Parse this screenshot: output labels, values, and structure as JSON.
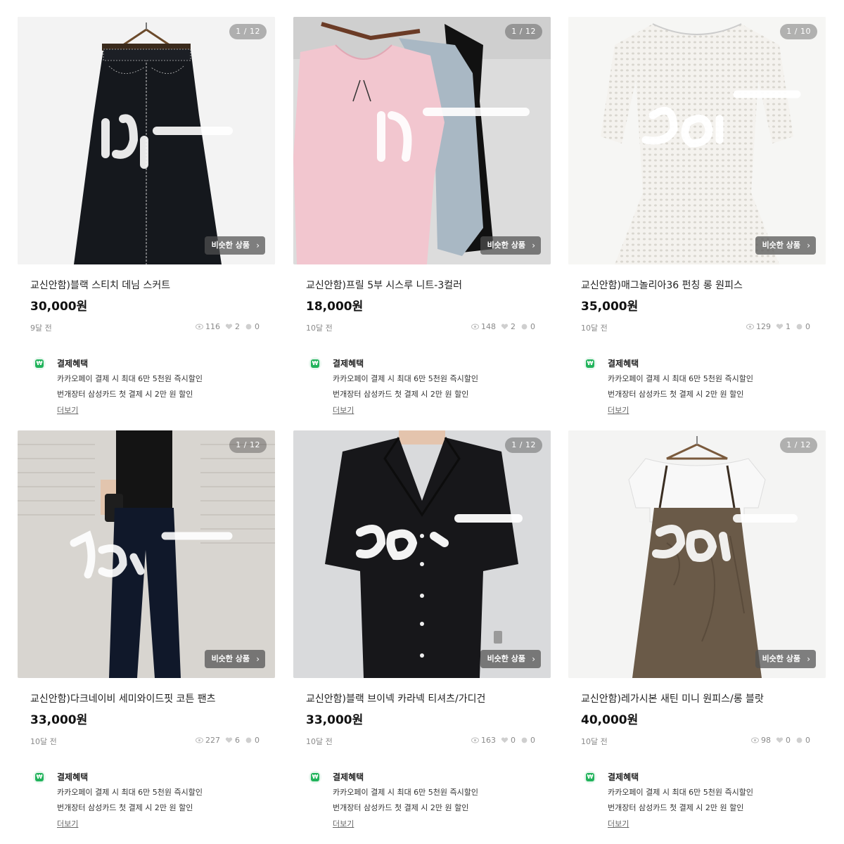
{
  "products": [
    {
      "title": "교신안함)블랙 스티치 데님 스커트",
      "price": "30,000원",
      "time": "9달 전",
      "views": "116",
      "likes": "2",
      "chats": "0",
      "counter": "1 / 12",
      "similar_label": "비슷한 상품",
      "image_icon": "black-denim-skirt"
    },
    {
      "title": "교신안함)프릴 5부 시스루 니트-3컬러",
      "price": "18,000원",
      "time": "10달 전",
      "views": "148",
      "likes": "2",
      "chats": "0",
      "counter": "1 / 12",
      "similar_label": "비슷한 상품",
      "image_icon": "pink-knit-tops"
    },
    {
      "title": "교신안함)매그놀리아36 펀칭 롱 원피스",
      "price": "35,000원",
      "time": "10달 전",
      "views": "129",
      "likes": "1",
      "chats": "0",
      "counter": "1 / 10",
      "similar_label": "비슷한 상품",
      "image_icon": "white-eyelet-dress"
    },
    {
      "title": "교신안함)다크네이비 세미와이드핏 코튼 팬츠",
      "price": "33,000원",
      "time": "10달 전",
      "views": "227",
      "likes": "6",
      "chats": "0",
      "counter": "1 / 12",
      "similar_label": "비슷한 상품",
      "image_icon": "navy-wide-pants"
    },
    {
      "title": "교신안함)블랙 브이넥 카라넥 티셔츠/가디건",
      "price": "33,000원",
      "time": "10달 전",
      "views": "163",
      "likes": "0",
      "chats": "0",
      "counter": "1 / 12",
      "similar_label": "비슷한 상품",
      "image_icon": "black-collar-cardigan"
    },
    {
      "title": "교신안함)레가시본 새틴 미니 원피스/롱 블랏",
      "price": "40,000원",
      "time": "10달 전",
      "views": "98",
      "likes": "0",
      "chats": "0",
      "counter": "1 / 12",
      "similar_label": "비슷한 상품",
      "image_icon": "brown-satin-dress"
    }
  ],
  "benefit": {
    "badge": "₩",
    "title": "결제혜택",
    "line1": "카카오페이 결제 시 최대 6만 5천원 즉시할인",
    "line2": "번개장터 삼성카드 첫 결제 시 2만 원  할인",
    "more": "더보기"
  },
  "colors": {
    "accent_green": "#21b35b",
    "price_text": "#111111",
    "meta_text": "#8a8a8a"
  }
}
